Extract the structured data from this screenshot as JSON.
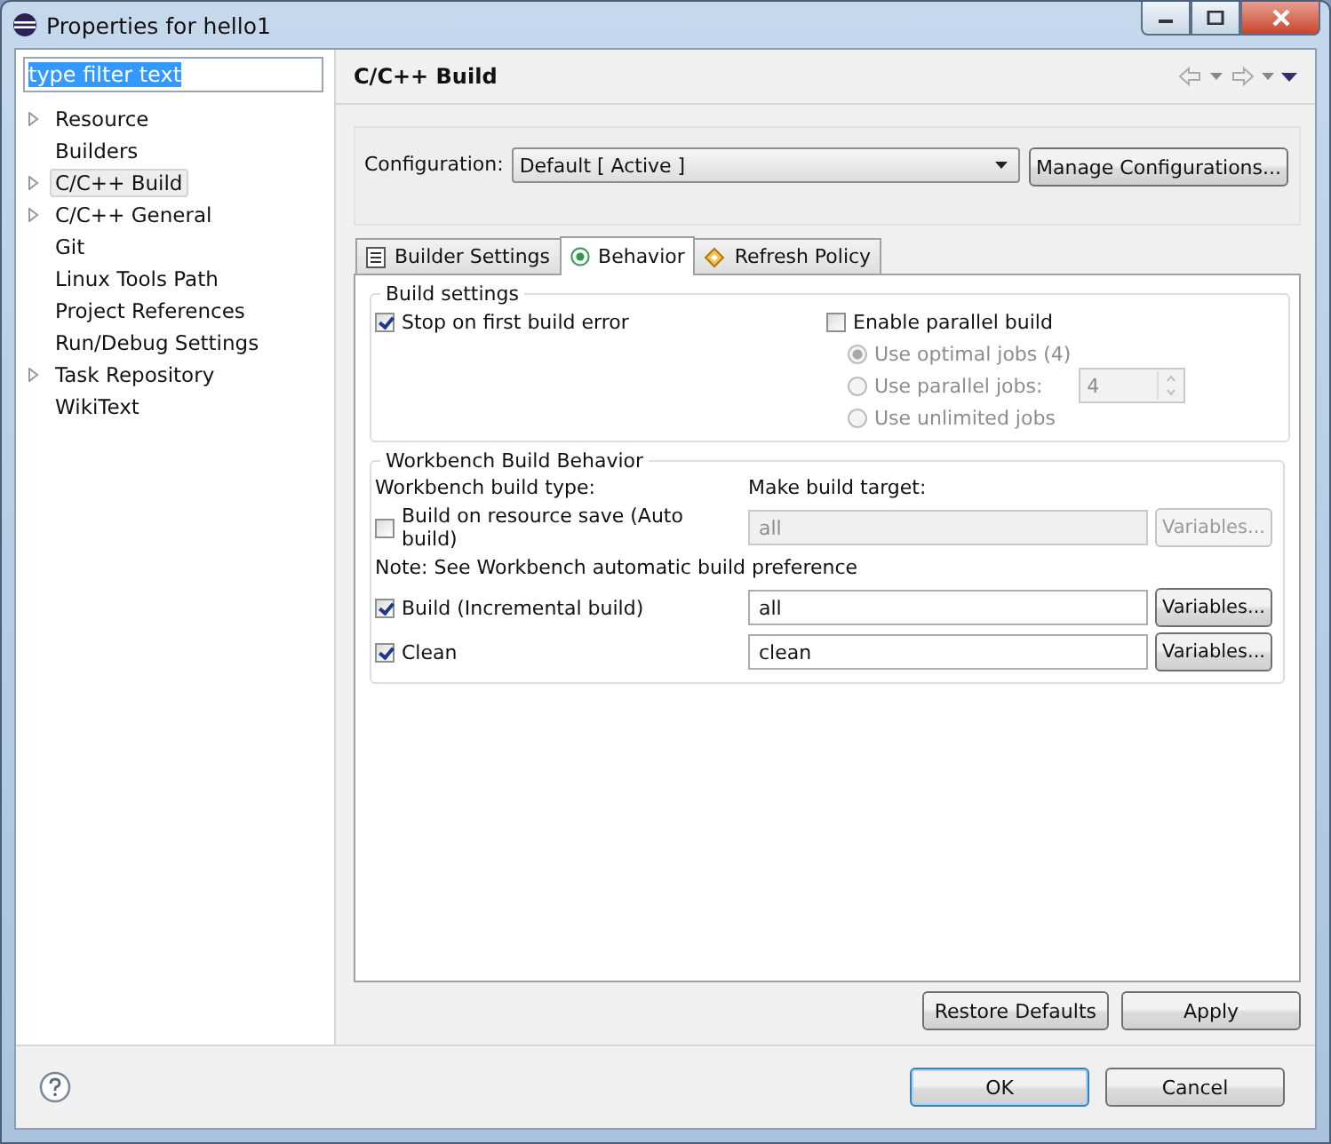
{
  "window": {
    "title": "Properties for hello1"
  },
  "filter": {
    "value": "type filter text"
  },
  "tree": [
    {
      "label": "Resource",
      "expandable": true,
      "selected": false
    },
    {
      "label": "Builders",
      "expandable": false,
      "selected": false
    },
    {
      "label": "C/C++ Build",
      "expandable": true,
      "selected": true
    },
    {
      "label": "C/C++ General",
      "expandable": true,
      "selected": false
    },
    {
      "label": "Git",
      "expandable": false,
      "selected": false
    },
    {
      "label": "Linux Tools Path",
      "expandable": false,
      "selected": false
    },
    {
      "label": "Project References",
      "expandable": false,
      "selected": false
    },
    {
      "label": "Run/Debug Settings",
      "expandable": false,
      "selected": false
    },
    {
      "label": "Task Repository",
      "expandable": true,
      "selected": false
    },
    {
      "label": "WikiText",
      "expandable": false,
      "selected": false
    }
  ],
  "page": {
    "title": "C/C++ Build"
  },
  "configuration": {
    "label": "Configuration:",
    "value": "Default  [ Active ]",
    "button": "Manage Configurations..."
  },
  "tabs": [
    {
      "label": "Builder Settings",
      "kind": "list",
      "selected": false
    },
    {
      "label": "Behavior",
      "kind": "radio",
      "selected": true
    },
    {
      "label": "Refresh Policy",
      "kind": "refresh",
      "selected": false
    }
  ],
  "build_settings": {
    "title": "Build settings",
    "stop_on_error": {
      "label": "Stop on first build error",
      "checked": true
    },
    "parallel": {
      "label": "Enable parallel build",
      "checked": false
    },
    "job_options": [
      {
        "label": "Use optimal jobs (4)",
        "selected": true,
        "disabled": true
      },
      {
        "label": "Use parallel jobs:",
        "selected": false,
        "disabled": true,
        "spinner": "4"
      },
      {
        "label": "Use unlimited jobs",
        "selected": false,
        "disabled": true
      }
    ]
  },
  "workbench": {
    "title": "Workbench Build Behavior",
    "type_label": "Workbench build type:",
    "target_label": "Make build target:",
    "rows": [
      {
        "kind": "option",
        "label": "Build on resource save (Auto build)",
        "checked": false,
        "target": "all",
        "disabled": true,
        "button": "Variables..."
      },
      {
        "kind": "note",
        "label": "Note: See Workbench automatic build preference"
      },
      {
        "kind": "option",
        "label": "Build (Incremental build)",
        "checked": true,
        "target": "all",
        "disabled": false,
        "button": "Variables..."
      },
      {
        "kind": "option",
        "label": "Clean",
        "checked": true,
        "target": "clean",
        "disabled": false,
        "button": "Variables..."
      }
    ]
  },
  "page_buttons": [
    "Restore Defaults",
    "Apply"
  ],
  "dialog_buttons": [
    {
      "label": "OK",
      "default": true
    },
    {
      "label": "Cancel",
      "default": false
    }
  ]
}
